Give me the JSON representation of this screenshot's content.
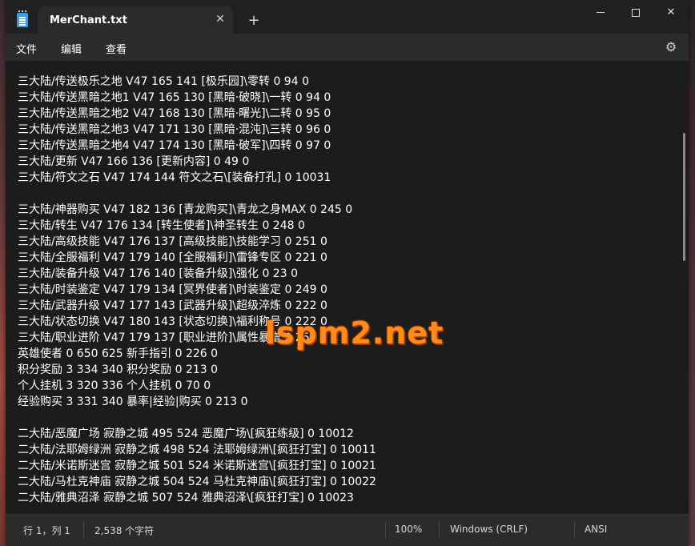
{
  "titlebar": {
    "tab_title": "MerChant.txt",
    "tab_close_glyph": "✕",
    "new_tab_glyph": "+",
    "close_glyph": "✕"
  },
  "menu": {
    "file": "文件",
    "edit": "编辑",
    "view": "查看",
    "settings_icon": "⚙"
  },
  "editor": {
    "lines": [
      "三大陆/传送极乐之地 V47 165 141 [极乐园]\\零转 0 94 0",
      "三大陆/传送黑暗之地1 V47 165 130 [黑暗·破晓]\\一转 0 94 0",
      "三大陆/传送黑暗之地2 V47 168 130 [黑暗·曙光]\\二转 0 95 0",
      "三大陆/传送黑暗之地3 V47 171 130 [黑暗·混沌]\\三转 0 96 0",
      "三大陆/传送黑暗之地4 V47 174 130 [黑暗·破军]\\四转 0 97 0",
      "三大陆/更新 V47 166 136 [更新内容] 0 49 0",
      "三大陆/符文之石 V47 174 144 符文之石\\[装备打孔] 0 10031",
      "",
      "三大陆/神器购买 V47 182 136 [青龙购买]\\青龙之身MAX 0 245 0",
      "三大陆/转生 V47 176 134 [转生使者]\\神圣转生 0 248 0",
      "三大陆/高级技能 V47 176 137 [高级技能]\\技能学习 0 251 0",
      "三大陆/全服福利 V47 179 140 [全服福利]\\雷锋专区 0 221 0",
      "三大陆/装备升级 V47 176 140 [装备升级]\\强化 0 23 0",
      "三大陆/时装鉴定 V47 179 134 [冥界使者]\\时装鉴定 0 249 0",
      "三大陆/武器升级 V47 177 143 [武器升级]\\超级淬炼 0 222 0",
      "三大陆/状态切换 V47 180 143 [状态切换]\\福利称号 0 222 0",
      "三大陆/职业进阶 V47 179 137 [职业进阶]\\属性暴增 0 250 0",
      "英雄使者 0 650 625 新手指引 0 226 0",
      "积分奖励 3 334 340 积分奖励 0 213 0",
      "个人挂机 3 320 336 个人挂机 0 70 0",
      "经验购买 3 331 340 暴率|经验|购买 0 213 0",
      "",
      "二大陆/恶魔广场 寂静之城 495 524 恶魔广场\\[疯狂练级] 0 10012",
      "二大陆/法耶姆绿洲 寂静之城 498 524 法耶姆绿洲\\[疯狂打宝] 0 10011",
      "二大陆/米诺斯迷宫 寂静之城 501 524 米诺斯迷宫\\[疯狂打宝] 0 10021",
      "二大陆/马杜克神庙 寂静之城 504 524 马杜克神庙\\[疯狂打宝] 0 10022",
      "二大陆/雅典沼泽 寂静之城 507 524 雅典沼泽\\[疯狂打宝] 0 10023"
    ]
  },
  "watermark": "lspm2.net",
  "statusbar": {
    "position": "行 1，列 1",
    "char_count": "2,538 个字符",
    "zoom": "100%",
    "line_ending": "Windows (CRLF)",
    "encoding": "ANSI"
  },
  "colors": {
    "editor_bg": "#1c1c1c",
    "chrome_bg": "#2b2b2b",
    "text": "#ffffff",
    "watermark": "#ff8a1e"
  }
}
